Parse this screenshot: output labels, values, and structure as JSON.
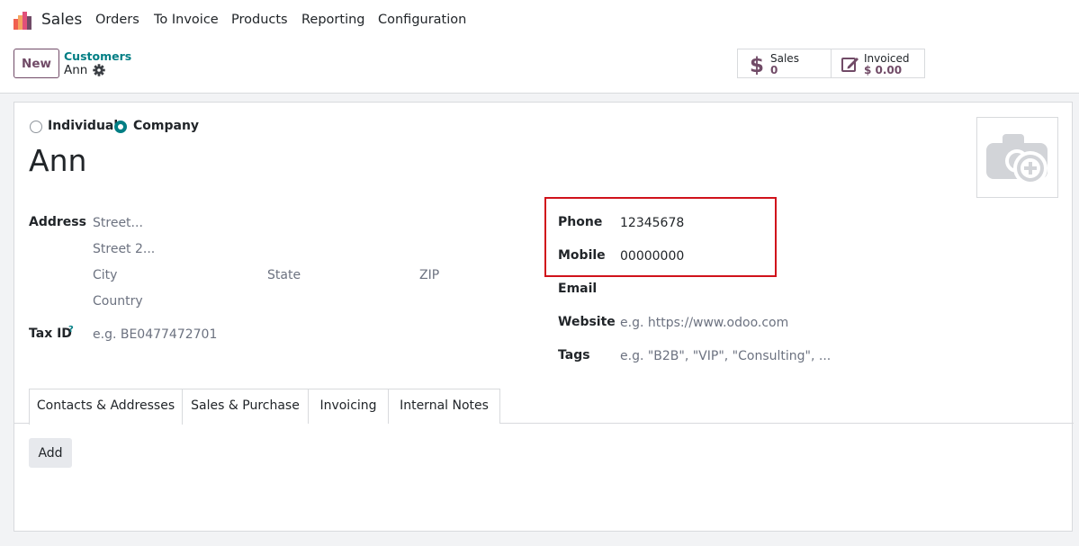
{
  "topnav": {
    "app_name": "Sales",
    "menu": [
      "Orders",
      "To Invoice",
      "Products",
      "Reporting",
      "Configuration"
    ]
  },
  "control": {
    "new_label": "New",
    "breadcrumb_parent": "Customers",
    "breadcrumb_current": "Ann",
    "stats": [
      {
        "label": "Sales",
        "value": "0",
        "icon": "dollar-icon"
      },
      {
        "label": "Invoiced",
        "value": "$ 0.00",
        "icon": "edit-invoice-icon"
      }
    ]
  },
  "form": {
    "type_options": [
      "Individual",
      "Company"
    ],
    "type_selected": "Company",
    "name": "Ann",
    "address_label": "Address",
    "street_placeholder": "Street...",
    "street2_placeholder": "Street 2...",
    "city_placeholder": "City",
    "state_placeholder": "State",
    "zip_placeholder": "ZIP",
    "country_placeholder": "Country",
    "taxid_label": "Tax ID",
    "taxid_help": "?",
    "taxid_placeholder": "e.g. BE0477472701",
    "phone_label": "Phone",
    "phone_value": "12345678",
    "mobile_label": "Mobile",
    "mobile_value": "00000000",
    "email_label": "Email",
    "website_label": "Website",
    "website_placeholder": "e.g. https://www.odoo.com",
    "tags_label": "Tags",
    "tags_placeholder": "e.g. \"B2B\", \"VIP\", \"Consulting\", ..."
  },
  "tabs": [
    "Contacts & Addresses",
    "Sales & Purchase",
    "Invoicing",
    "Internal Notes"
  ],
  "active_tab": "Contacts & Addresses",
  "add_label": "Add",
  "colors": {
    "brand": "#714b67",
    "accent": "#017e84",
    "highlight": "#d0121b"
  }
}
